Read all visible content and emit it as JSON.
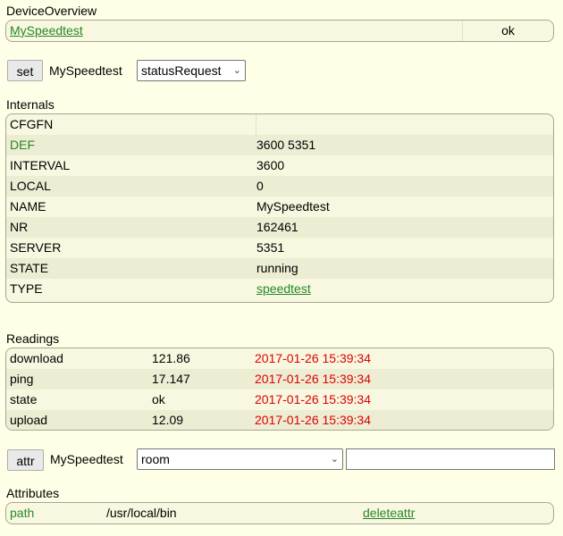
{
  "device_overview": {
    "title": "DeviceOverview",
    "device_name": "MySpeedtest",
    "status": "ok"
  },
  "set_row": {
    "button": "set",
    "device": "MySpeedtest",
    "selected": "statusRequest"
  },
  "internals": {
    "title": "Internals",
    "rows": [
      {
        "key": "CFGFN",
        "value": ""
      },
      {
        "key": "DEF",
        "value": "3600 5351"
      },
      {
        "key": "INTERVAL",
        "value": "3600"
      },
      {
        "key": "LOCAL",
        "value": "0"
      },
      {
        "key": "NAME",
        "value": "MySpeedtest"
      },
      {
        "key": "NR",
        "value": "162461"
      },
      {
        "key": "SERVER",
        "value": "5351"
      },
      {
        "key": "STATE",
        "value": "running"
      },
      {
        "key": "TYPE",
        "value": "speedtest"
      }
    ]
  },
  "readings": {
    "title": "Readings",
    "rows": [
      {
        "name": "download",
        "value": "121.86",
        "time": "2017-01-26 15:39:34"
      },
      {
        "name": "ping",
        "value": "17.147",
        "time": "2017-01-26 15:39:34"
      },
      {
        "name": "state",
        "value": "ok",
        "time": "2017-01-26 15:39:34"
      },
      {
        "name": "upload",
        "value": "12.09",
        "time": "2017-01-26 15:39:34"
      }
    ]
  },
  "attr_row": {
    "button": "attr",
    "device": "MySpeedtest",
    "selected": "room",
    "value": ""
  },
  "attributes": {
    "title": "Attributes",
    "rows": [
      {
        "name": "path",
        "value": "/usr/local/bin",
        "action": "deleteattr"
      }
    ]
  },
  "colors": {
    "background": "#FFFFE7",
    "link": "#278727",
    "timestamp": "#e00000",
    "row_alt": "#EDEDD4"
  }
}
